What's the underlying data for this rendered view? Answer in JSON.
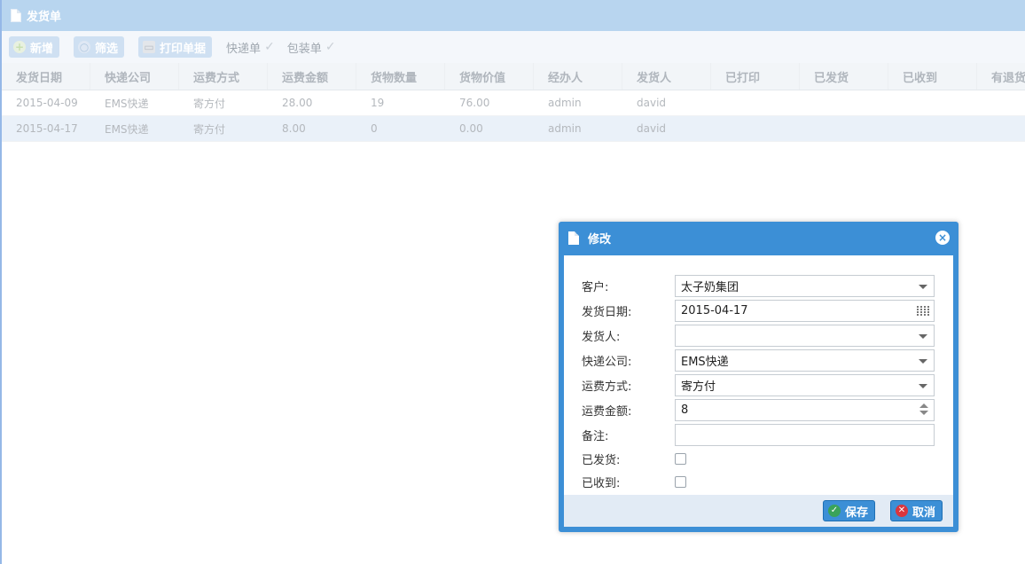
{
  "panel": {
    "title": "发货单"
  },
  "toolbar": {
    "add_label": "新增",
    "filter_label": "筛选",
    "print_label": "打印单据",
    "express_label": "快递单",
    "packing_label": "包装单",
    "check_glyph": "✓"
  },
  "grid": {
    "columns": [
      "发货日期",
      "快递公司",
      "运费方式",
      "运费金额",
      "货物数量",
      "货物价值",
      "经办人",
      "发货人",
      "已打印",
      "已发货",
      "已收到",
      "有退货"
    ],
    "rows": [
      [
        "2015-04-09",
        "EMS快递",
        "寄方付",
        "28.00",
        "19",
        "76.00",
        "admin",
        "david",
        "",
        "",
        "",
        ""
      ],
      [
        "2015-04-17",
        "EMS快递",
        "寄方付",
        "8.00",
        "0",
        "0.00",
        "admin",
        "david",
        "",
        "",
        "",
        ""
      ]
    ]
  },
  "dialog": {
    "title": "修改",
    "close_glyph": "×",
    "fields": {
      "customer_label": "客户:",
      "customer_value": "太子奶集团",
      "ship_date_label": "发货日期:",
      "ship_date_value": "2015-04-17",
      "shipper_label": "发货人:",
      "shipper_value": "",
      "courier_label": "快递公司:",
      "courier_value": "EMS快递",
      "freight_method_label": "运费方式:",
      "freight_method_value": "寄方付",
      "freight_amount_label": "运费金额:",
      "freight_amount_value": "8",
      "remark_label": "备注:",
      "remark_value": "",
      "shipped_label": "已发货:",
      "received_label": "已收到:"
    },
    "save_label": "保存",
    "cancel_label": "取消",
    "ok_glyph": "✓",
    "cancel_glyph": "✕"
  },
  "colors": {
    "dialog_header": "#3c8fd6",
    "panel_header": "#b8d5ef",
    "selected_row": "#eaf1f9"
  }
}
